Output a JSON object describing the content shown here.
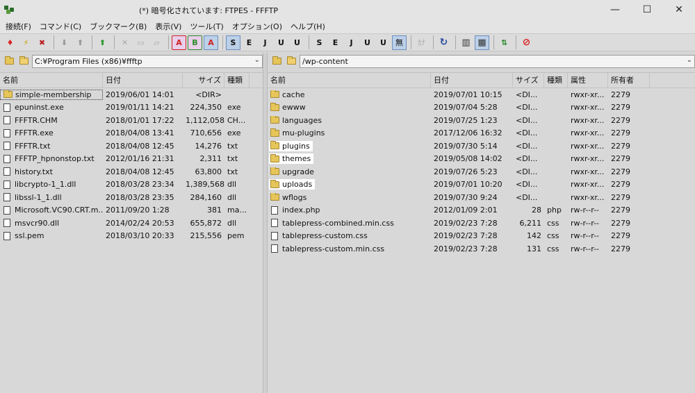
{
  "window": {
    "title": "(*) 暗号化されています: FTPES - FFFTP",
    "minimize": "—",
    "maximize": "☐",
    "close": "✕"
  },
  "menu": [
    "接続(F)",
    "コマンド(C)",
    "ブックマーク(B)",
    "表示(V)",
    "ツール(T)",
    "オプション(O)",
    "ヘルプ(H)"
  ],
  "toolbar": {
    "connect": "♦",
    "quick": "⚡",
    "disconnect": "✖",
    "down": "⬇",
    "up": "⬆",
    "mirror": "⬆",
    "delete": "✕",
    "b_a": "A",
    "b_b": "B",
    "b_auto": "A",
    "s_s": "S",
    "s_e": "E",
    "s_j": "J",
    "s_u": "U",
    "s_u2": "U",
    "r_s": "S",
    "r_e": "E",
    "r_j": "J",
    "r_u": "U",
    "r_u2": "U",
    "nochange": "無",
    "kana": "ｶﾅ",
    "refresh": "↻",
    "list": "▥",
    "detail": "▦",
    "sync": "⇅",
    "stop": "⊘"
  },
  "local": {
    "path": "C:¥Program Files (x86)¥ffftp",
    "headers": [
      "名前",
      "日付",
      "サイズ",
      "種類"
    ],
    "files": [
      {
        "name": "simple-membership",
        "date": "2019/06/01 14:01",
        "size": "<DIR>",
        "type": "",
        "folder": true
      },
      {
        "name": "epuninst.exe",
        "date": "2019/01/11 14:21",
        "size": "224,350",
        "type": "exe"
      },
      {
        "name": "FFFTR.CHM",
        "date": "2018/01/01 17:22",
        "size": "1,112,058",
        "type": "CH..."
      },
      {
        "name": "FFFTR.exe",
        "date": "2018/04/08 13:41",
        "size": "710,656",
        "type": "exe"
      },
      {
        "name": "FFFTR.txt",
        "date": "2018/04/08 12:45",
        "size": "14,276",
        "type": "txt"
      },
      {
        "name": "FFFTP_hpnonstop.txt",
        "date": "2012/01/16 21:31",
        "size": "2,311",
        "type": "txt"
      },
      {
        "name": "history.txt",
        "date": "2018/04/08 12:45",
        "size": "63,800",
        "type": "txt"
      },
      {
        "name": "libcrypto-1_1.dll",
        "date": "2018/03/28 23:34",
        "size": "1,389,568",
        "type": "dll"
      },
      {
        "name": "libssl-1_1.dll",
        "date": "2018/03/28 23:35",
        "size": "284,160",
        "type": "dll"
      },
      {
        "name": "Microsoft.VC90.CRT.m...",
        "date": "2011/09/20 1:28",
        "size": "381",
        "type": "ma..."
      },
      {
        "name": "msvcr90.dll",
        "date": "2014/02/24 20:53",
        "size": "655,872",
        "type": "dll"
      },
      {
        "name": "ssl.pem",
        "date": "2018/03/10 20:33",
        "size": "215,556",
        "type": "pem"
      }
    ]
  },
  "remote": {
    "path": "/wp-content",
    "headers": [
      "名前",
      "日付",
      "サイズ",
      "種類",
      "属性",
      "所有者"
    ],
    "files": [
      {
        "name": "cache",
        "date": "2019/07/01 10:15",
        "size": "<DI...",
        "type": "",
        "attr": "rwxr-xr...",
        "owner": "2279",
        "folder": true
      },
      {
        "name": "ewww",
        "date": "2019/07/04 5:28",
        "size": "<DI...",
        "type": "",
        "attr": "rwxr-xr...",
        "owner": "2279",
        "folder": true
      },
      {
        "name": "languages",
        "date": "2019/07/25 1:23",
        "size": "<DI...",
        "type": "",
        "attr": "rwxr-xr...",
        "owner": "2279",
        "folder": true
      },
      {
        "name": "mu-plugins",
        "date": "2017/12/06 16:32",
        "size": "<DI...",
        "type": "",
        "attr": "rwxr-xr...",
        "owner": "2279",
        "folder": true
      },
      {
        "name": "plugins",
        "date": "2019/07/30 5:14",
        "size": "<DI...",
        "type": "",
        "attr": "rwxr-xr...",
        "owner": "2279",
        "folder": true,
        "hl": true
      },
      {
        "name": "themes",
        "date": "2019/05/08 14:02",
        "size": "<DI...",
        "type": "",
        "attr": "rwxr-xr...",
        "owner": "2279",
        "folder": true,
        "hl": true
      },
      {
        "name": "upgrade",
        "date": "2019/07/26 5:23",
        "size": "<DI...",
        "type": "",
        "attr": "rwxr-xr...",
        "owner": "2279",
        "folder": true
      },
      {
        "name": "uploads",
        "date": "2019/07/01 10:20",
        "size": "<DI...",
        "type": "",
        "attr": "rwxr-xr...",
        "owner": "2279",
        "folder": true,
        "hl": true
      },
      {
        "name": "wflogs",
        "date": "2019/07/30 9:24",
        "size": "<DI...",
        "type": "",
        "attr": "rwxr-xr...",
        "owner": "2279",
        "folder": true
      },
      {
        "name": "index.php",
        "date": "2012/01/09 2:01",
        "size": "28",
        "type": "php",
        "attr": "rw-r--r--",
        "owner": "2279"
      },
      {
        "name": "tablepress-combined.min.css",
        "date": "2019/02/23 7:28",
        "size": "6,211",
        "type": "css",
        "attr": "rw-r--r--",
        "owner": "2279"
      },
      {
        "name": "tablepress-custom.css",
        "date": "2019/02/23 7:28",
        "size": "142",
        "type": "css",
        "attr": "rw-r--r--",
        "owner": "2279"
      },
      {
        "name": "tablepress-custom.min.css",
        "date": "2019/02/23 7:28",
        "size": "131",
        "type": "css",
        "attr": "rw-r--r--",
        "owner": "2279"
      }
    ]
  }
}
